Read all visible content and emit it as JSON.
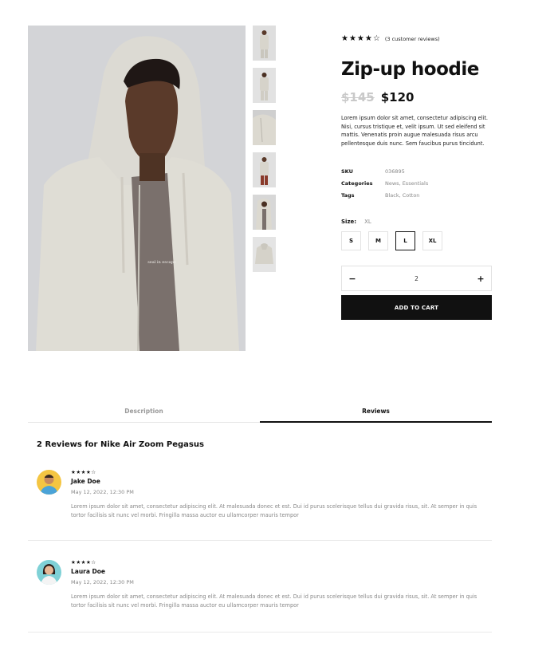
{
  "product": {
    "rating_stars": "★★★★☆",
    "review_count": "(3 customer reviews)",
    "title": "Zip-up hoodie",
    "old_price": "$145",
    "new_price": "$120",
    "description": "Lorem ipsum dolor sit amet, consectetur adipiscing elit. Nisi, cursus tristique et, velit ipsum. Ut sed eleifend sit mattis. Venenatis proin augue malesuada risus arcu pellentesque duis nunc. Sem faucibus purus tincidunt.",
    "graphic_text": "seal in escape",
    "meta": [
      {
        "key": "SKU",
        "value": "036895"
      },
      {
        "key": "Categories",
        "value": "News, Essentials"
      },
      {
        "key": "Tags",
        "value": "Black, Cotton"
      }
    ],
    "size_label": "Size:",
    "size_selected": "XL",
    "sizes": [
      "S",
      "M",
      "L",
      "XL"
    ],
    "quantity": {
      "minus": "−",
      "value": "2",
      "plus": "+"
    },
    "add_to_cart": "ADD TO CART"
  },
  "tabs": [
    "Description",
    "Reviews"
  ],
  "reviews_heading": "2 Reviews for Nike Air Zoom Pegasus",
  "reviews": [
    {
      "stars": "★★★★☆",
      "name": "Jake Doe",
      "date": "May 12, 2022, 12:30 PM",
      "text": "Lorem ipsum dolor sit amet, consectetur adipiscing elit. At malesuada donec et est. Dui id purus scelerisque tellus dui gravida risus, sit. At semper in quis tortor facilisis sit nunc vel morbi. Fringilla massa auctor eu ullamcorper mauris tempor"
    },
    {
      "stars": "★★★★☆",
      "name": "Laura Doe",
      "date": "May 12, 2022, 12:30 PM",
      "text": "Lorem ipsum dolor sit amet, consectetur adipiscing elit. At malesuada donec et est. Dui id purus scelerisque tellus dui gravida risus, sit. At semper in quis tortor facilisis sit nunc vel morbi. Fringilla massa auctor eu ullamcorper mauris tempor"
    }
  ],
  "colors": {
    "accent": "#111111",
    "muted": "#888888",
    "old_price": "#c9c9c9"
  }
}
